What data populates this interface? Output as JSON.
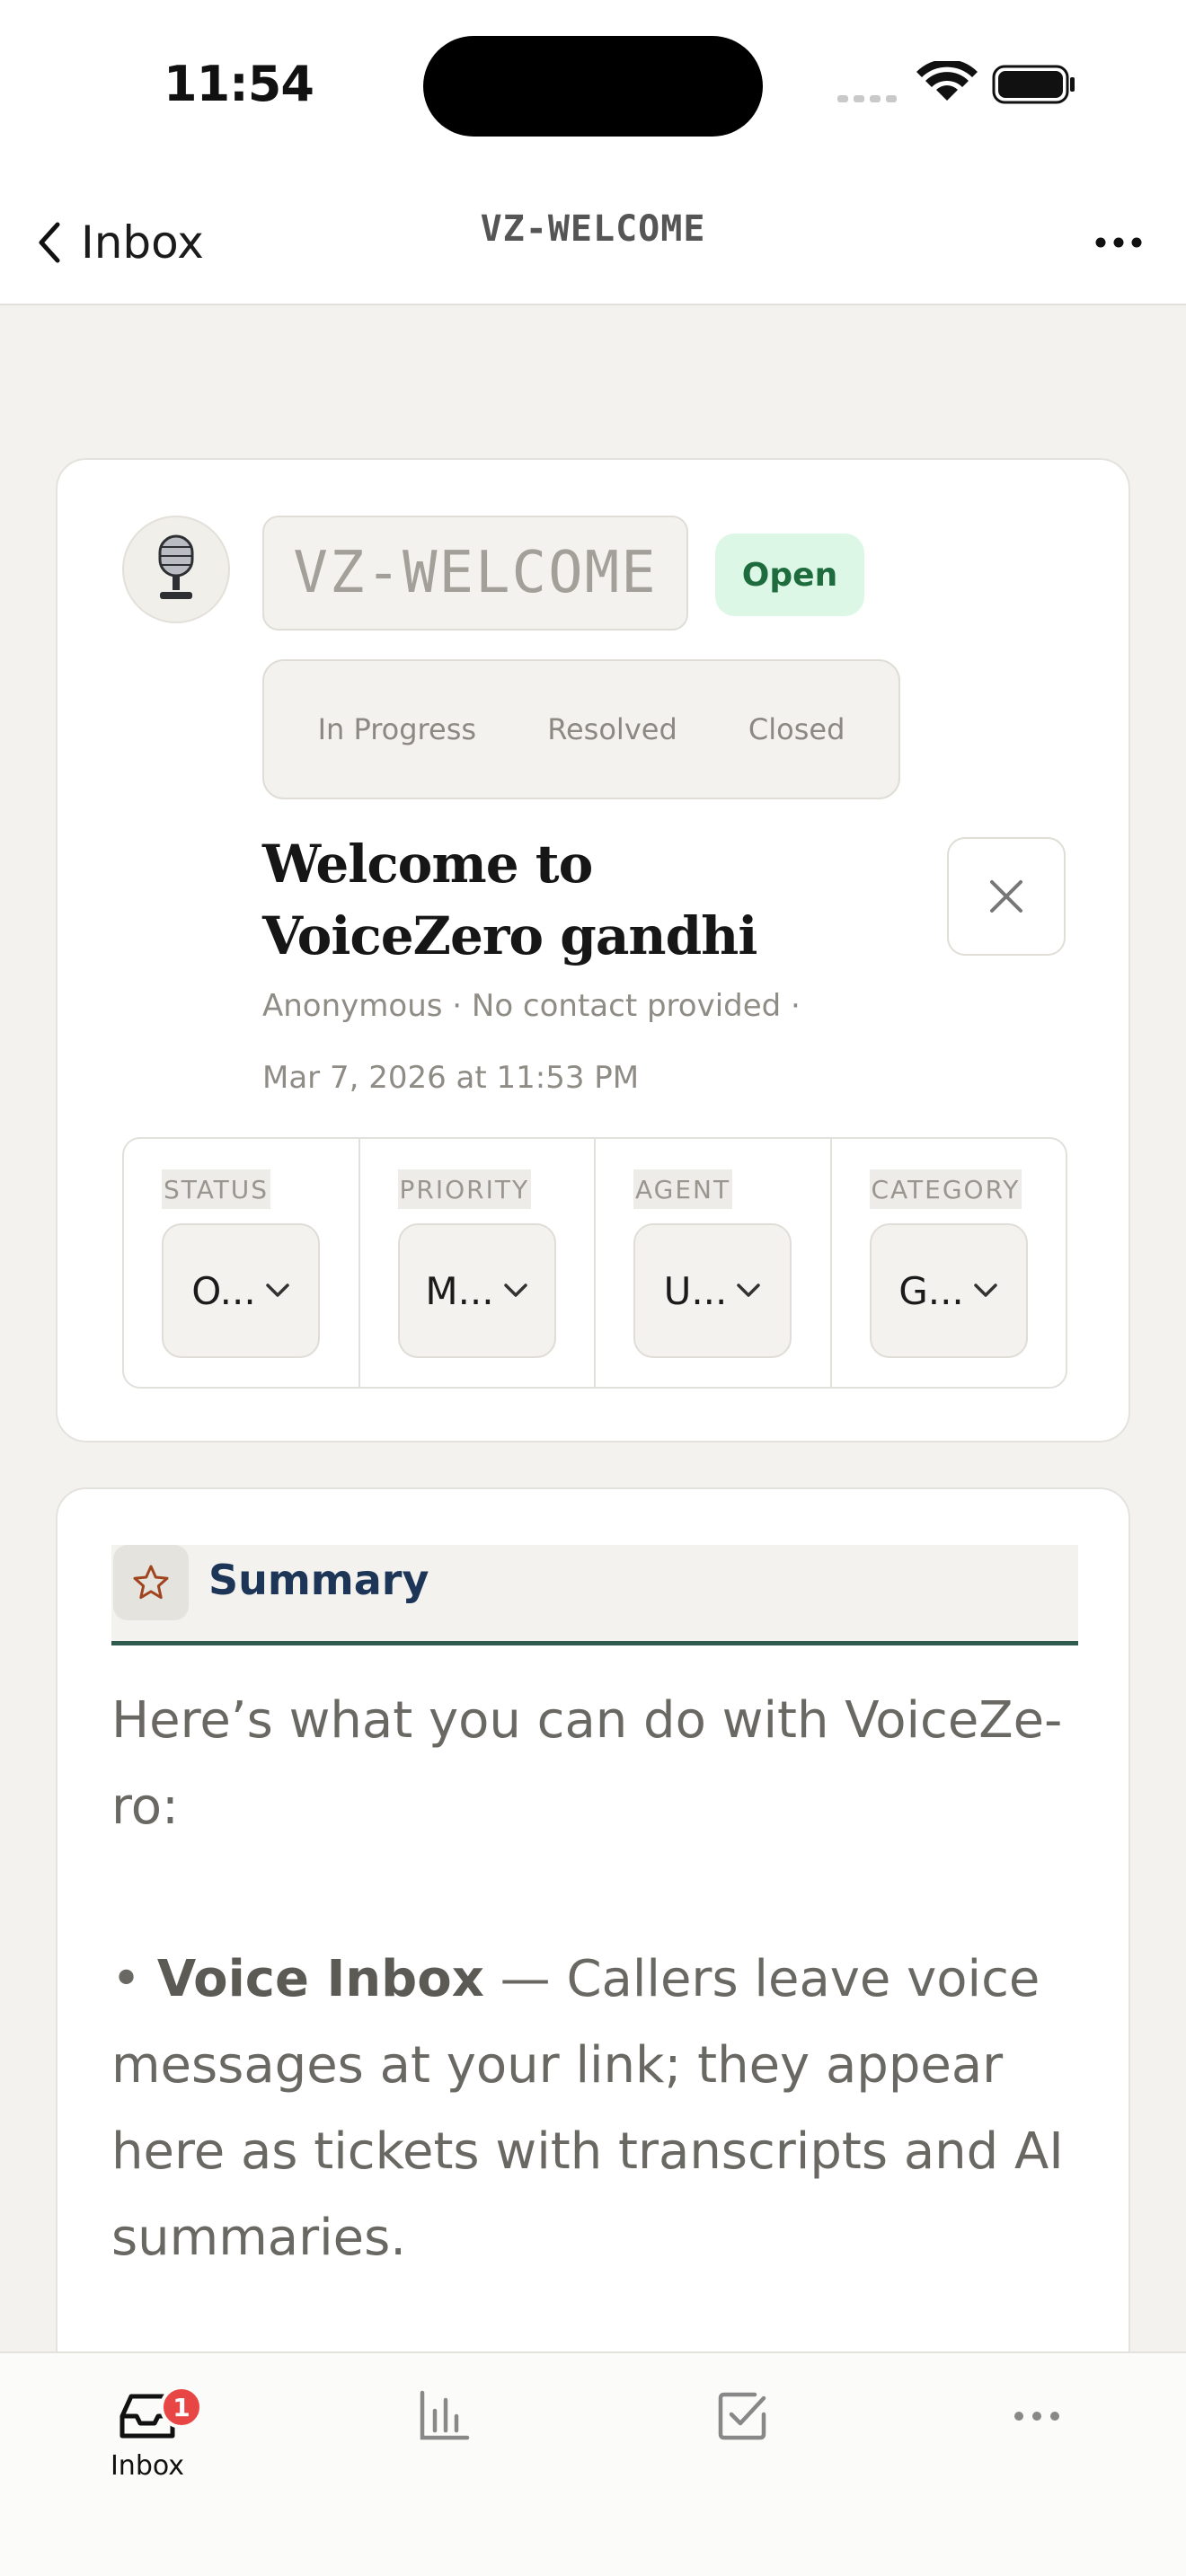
{
  "status_bar": {
    "time": "11:54"
  },
  "nav": {
    "back_label": "Inbox",
    "title": "VZ-WELCOME"
  },
  "ticket": {
    "id": "VZ-WELCOME",
    "status_pill": "Open",
    "status_options": [
      "In Progress",
      "Resolved",
      "Closed"
    ],
    "title": "Welcome to VoiceZero gandhi",
    "meta": "Anonymous · No contact provided  ·",
    "date": "Mar 7, 2026 at 11:53 PM",
    "fields": [
      {
        "label": "STATUS",
        "value": "O..."
      },
      {
        "label": "PRIORITY",
        "value": "M..."
      },
      {
        "label": "AGENT",
        "value": "U..."
      },
      {
        "label": "CATEGORY",
        "value": "G..."
      }
    ]
  },
  "summary": {
    "tab_label": "Summary",
    "intro": "Here’s what you can do with VoiceZe-ro:",
    "bullet_prefix": "• ",
    "bullet_title": "Voice Inbox",
    "bullet_text": " — Callers leave voice messages at your link; they appear here as tickets with transcripts and AI summaries."
  },
  "tabbar": {
    "inbox_label": "Inbox",
    "inbox_badge": "1"
  },
  "colors": {
    "accent_green": "#1e6b3d",
    "pill_bg": "#ddf7e6",
    "badge_red": "#e84545",
    "summary_title": "#1d3557",
    "summary_underline": "#2f5a4e"
  }
}
